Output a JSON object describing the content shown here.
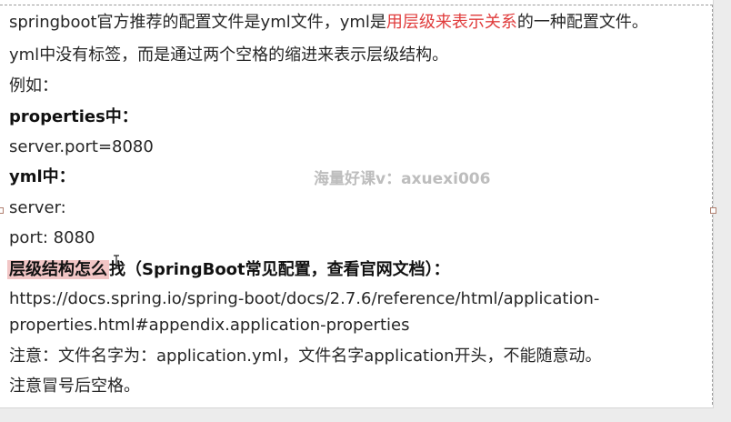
{
  "lines": {
    "l1": {
      "part1": "springboot官方推荐的配置文件是yml文件，yml是",
      "red": "用层级来表示关系",
      "part2": "的一种配置文件。"
    },
    "l2": "yml中没有标签，而是通过两个空格的缩进来表示层级结构。",
    "l3": "例如：",
    "l4": "properties中：",
    "l5": "server.port=8080",
    "l6": "yml中：",
    "l7": "server:",
    "l8": "port: 8080",
    "l9": {
      "highlight": "层级结构怎么",
      "rest": "找（SpringBoot常见配置，查看官网文档）："
    },
    "l10": "https://docs.spring.io/spring-boot/docs/2.7.6/reference/html/application-",
    "l11": "properties.html#appendix.application-properties",
    "l12": "注意：文件名字为：application.yml，文件名字application开头，不能随意动。",
    "l13": "注意冒号后空格。"
  },
  "watermark": "海量好课v：axuexi006",
  "colors": {
    "emphasis_red": "#e03c3c",
    "highlight_bg": "#f2c6c6",
    "text": "#262626"
  }
}
